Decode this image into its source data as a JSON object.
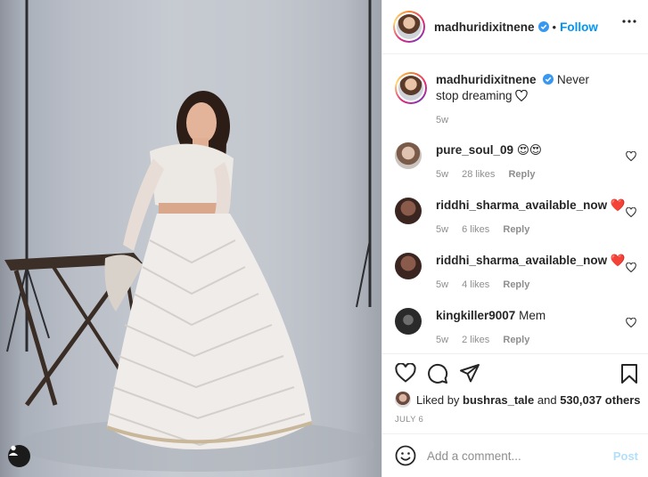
{
  "photo": {
    "alt_icon": "user-tag-icon"
  },
  "header": {
    "username": "madhuridixitnene",
    "separator": "•",
    "follow_label": "Follow",
    "more_icon": "more-horizontal-icon"
  },
  "caption": {
    "username": "madhuridixitnene",
    "text": "Never stop dreaming",
    "time": "5w"
  },
  "comments": [
    {
      "username": "pure_soul_09",
      "text": "😍😍",
      "time": "5w",
      "likes": "28 likes",
      "reply": "Reply"
    },
    {
      "username": "riddhi_sharma_available_now",
      "text": "❤️",
      "time": "5w",
      "likes": "6 likes",
      "reply": "Reply"
    },
    {
      "username": "riddhi_sharma_available_now",
      "text": "❤️",
      "time": "5w",
      "likes": "4 likes",
      "reply": "Reply"
    },
    {
      "username": "kingkiller9007",
      "text": "Mem",
      "time": "5w",
      "likes": "2 likes",
      "reply": "Reply"
    }
  ],
  "liked_by": {
    "prefix": "Liked by",
    "user": "bushras_tale",
    "and": "and",
    "others": "530,037 others"
  },
  "date": "JULY 6",
  "add_comment": {
    "placeholder": "Add a comment...",
    "post_label": "Post"
  },
  "colors": {
    "accent": "#0095f6",
    "post_disabled": "#b2dffc",
    "border": "#efefef",
    "muted": "#8e8e8e"
  }
}
